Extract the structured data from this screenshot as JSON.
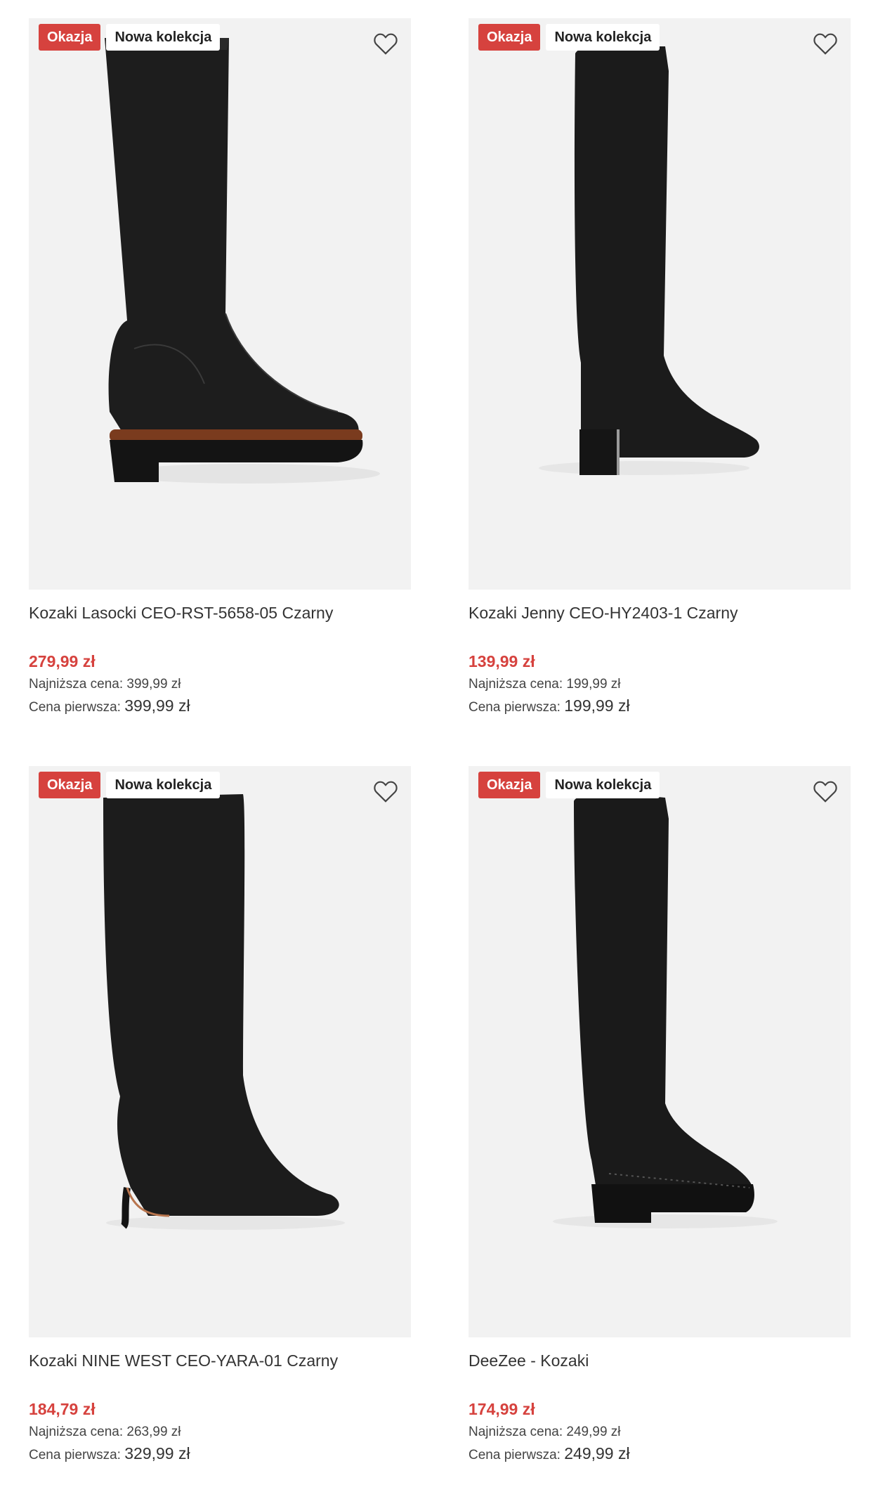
{
  "products": [
    {
      "badge_sale": "Okazja",
      "badge_new": "Nowa kolekcja",
      "title": "Kozaki Lasocki CEO-RST-5658-05 Czarny",
      "price": "279,99 zł",
      "lowest_label": "Najniższa cena:",
      "lowest_value": "399,99 zł",
      "first_label": "Cena pierwsza:",
      "first_value": "399,99 zł"
    },
    {
      "badge_sale": "Okazja",
      "badge_new": "Nowa kolekcja",
      "title": "Kozaki Jenny CEO-HY2403-1 Czarny",
      "price": "139,99 zł",
      "lowest_label": "Najniższa cena:",
      "lowest_value": "199,99 zł",
      "first_label": "Cena pierwsza:",
      "first_value": "199,99 zł"
    },
    {
      "badge_sale": "Okazja",
      "badge_new": "Nowa kolekcja",
      "title": "Kozaki NINE WEST CEO-YARA-01 Czarny",
      "price": "184,79 zł",
      "lowest_label": "Najniższa cena:",
      "lowest_value": "263,99 zł",
      "first_label": "Cena pierwsza:",
      "first_value": "329,99 zł"
    },
    {
      "badge_sale": "Okazja",
      "badge_new": "Nowa kolekcja",
      "title": "DeeZee - Kozaki",
      "price": "174,99 zł",
      "lowest_label": "Najniższa cena:",
      "lowest_value": "249,99 zł",
      "first_label": "Cena pierwsza:",
      "first_value": "249,99 zł"
    }
  ],
  "colors": {
    "sale_red": "#d6423e",
    "image_bg": "#f2f2f2",
    "text": "#333333"
  },
  "icons": {
    "wishlist": "heart-icon"
  }
}
